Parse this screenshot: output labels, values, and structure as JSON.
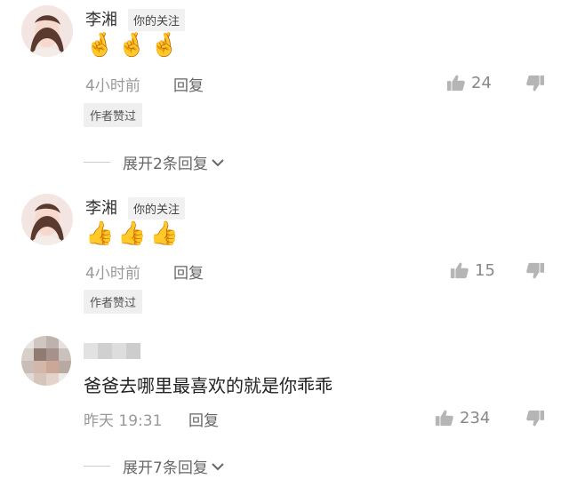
{
  "comments": [
    {
      "author": "李湘",
      "follow_tag": "你的关注",
      "content": "🤞🤞🤞",
      "time": "4小时前",
      "reply_label": "回复",
      "likes": "24",
      "author_liked": "作者赞过",
      "expand_label": "展开2条回复"
    },
    {
      "author": "李湘",
      "follow_tag": "你的关注",
      "content": "👍👍👍",
      "time": "4小时前",
      "reply_label": "回复",
      "likes": "15",
      "author_liked": "作者赞过"
    },
    {
      "content": "爸爸去哪里最喜欢的就是你乖乖",
      "time": "昨天 19:31",
      "reply_label": "回复",
      "likes": "234",
      "expand_label": "展开7条回复"
    }
  ],
  "icons": {
    "like": "thumbs-up-icon",
    "dislike": "thumbs-down-icon",
    "expand": "chevron-down-icon"
  },
  "colors": {
    "meta_gray": "#999999",
    "tag_bg": "#f1f1f1"
  }
}
